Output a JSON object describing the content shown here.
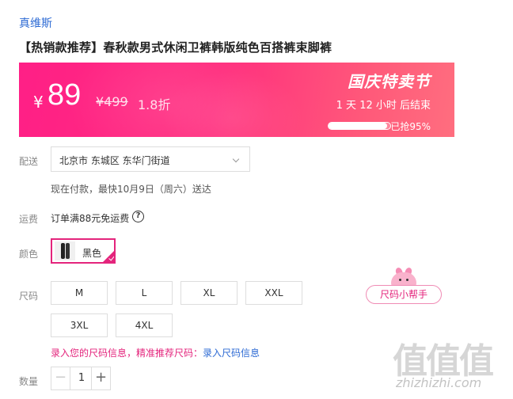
{
  "shop": {
    "name": "真维斯"
  },
  "product": {
    "title": "【热销款推荐】春秋款男式休闲卫裤韩版纯色百搭裤束脚裤"
  },
  "promo": {
    "currency": "¥",
    "price": "89",
    "original_price": "¥499",
    "discount": "1.8折",
    "event_title": "国庆特卖节",
    "countdown": "1 天 12 小时 后结束",
    "progress_percent": 95,
    "progress_label": "已抢95%",
    "colors": {
      "accent": "#e4247c",
      "banner": "#ff2e7e"
    }
  },
  "delivery": {
    "label": "配送",
    "address": "北京市 东城区 东华门街道",
    "note": "现在付款，最快10月9日（周六）送达"
  },
  "shipping": {
    "label": "运费",
    "text": "订单满88元免运费",
    "help_icon": "question-circle-icon"
  },
  "color": {
    "label": "颜色",
    "options": [
      {
        "name": "黑色",
        "selected": true
      }
    ]
  },
  "size": {
    "label": "尺码",
    "options": [
      "M",
      "L",
      "XL",
      "XXL",
      "3XL",
      "4XL"
    ],
    "helper": "尺码小帮手",
    "note_prefix": "录入您的尺码信息，精准推荐尺码：",
    "note_link": "录入尺码信息"
  },
  "quantity": {
    "label": "数量",
    "value": "1",
    "minus": "−",
    "plus": "+"
  },
  "watermark": {
    "logo": "值值值",
    "url": "zhizhizhi.com"
  }
}
